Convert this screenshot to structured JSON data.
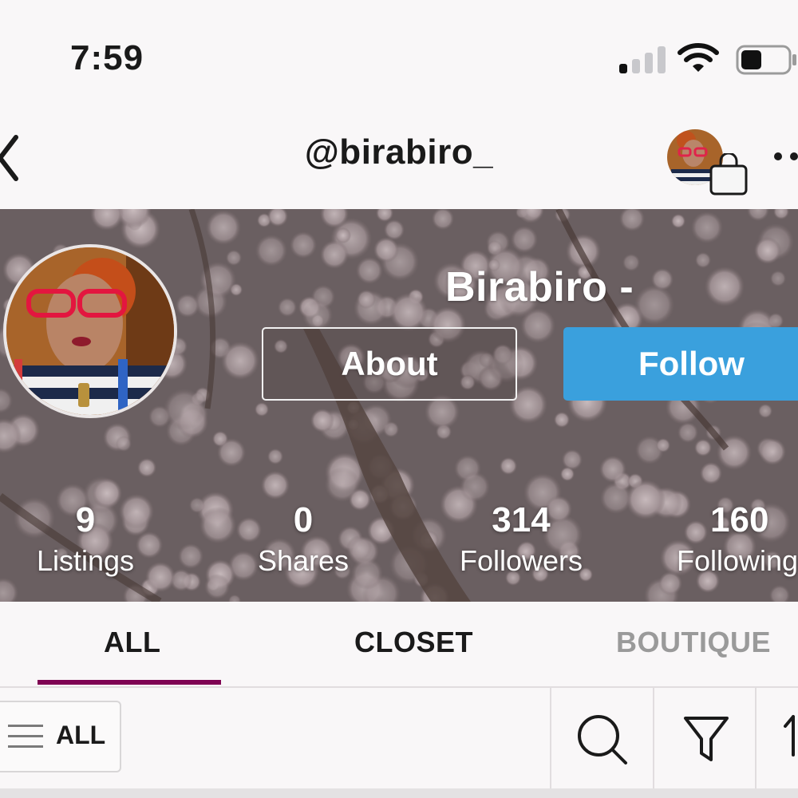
{
  "status_bar": {
    "time": "7:59",
    "signal_bars_active": 1,
    "signal_bars_total": 4,
    "battery_level_percent": 45,
    "icons": [
      "signal-icon",
      "wifi-icon",
      "battery-icon"
    ]
  },
  "nav": {
    "handle": "@birabiro_",
    "icons": [
      "back-chevron-icon",
      "shopping-bag-icon",
      "more-icon"
    ]
  },
  "profile": {
    "display_name": "Birabiro -",
    "about_label": "About",
    "follow_label": "Follow",
    "stats": [
      {
        "value": "9",
        "label": "Listings"
      },
      {
        "value": "0",
        "label": "Shares"
      },
      {
        "value": "314",
        "label": "Followers"
      },
      {
        "value": "160",
        "label": "Following"
      }
    ]
  },
  "tabs": [
    {
      "label": "ALL",
      "active": true
    },
    {
      "label": "CLOSET",
      "active": false
    },
    {
      "label": "BOUTIQUE",
      "active": false
    }
  ],
  "filter_bar": {
    "all_label": "ALL",
    "icons": [
      "hamburger-icon",
      "search-icon",
      "filter-icon",
      "sort-icon"
    ]
  },
  "colors": {
    "follow_button": "#3aa0dd",
    "active_tab_underline": "#7f0353",
    "inactive_tab_text": "#9a9a9a",
    "background": "#f9f7f8"
  }
}
